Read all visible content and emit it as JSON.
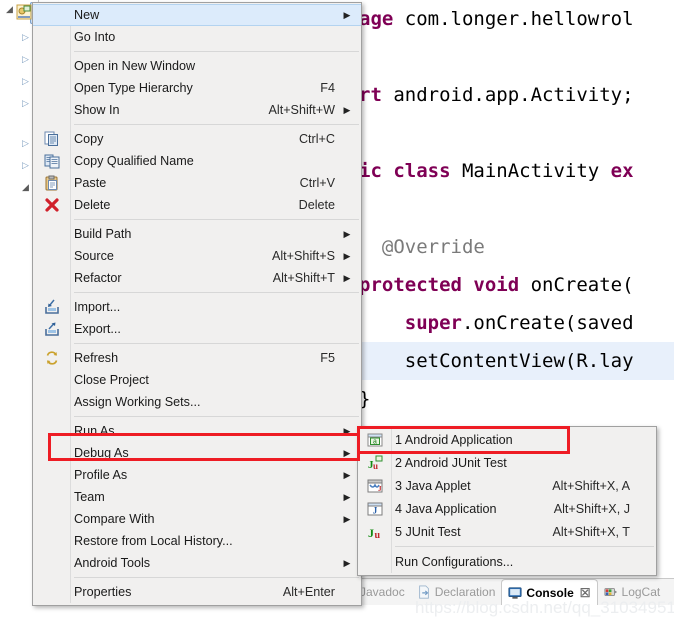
{
  "app": "Eclipse IDE - Package Explorer context menu",
  "editor": {
    "code_lines": [
      {
        "id": "l1",
        "segments": [
          {
            "t": "age ",
            "c": "kw"
          },
          {
            "t": "com.longer.hellowrol",
            "c": "plain"
          }
        ],
        "highlight": false
      },
      {
        "id": "l2",
        "segments": [
          {
            "t": "",
            "c": "plain"
          }
        ],
        "highlight": false
      },
      {
        "id": "l3",
        "segments": [
          {
            "t": "rt ",
            "c": "kw"
          },
          {
            "t": "android.app.Activity;",
            "c": "plain"
          }
        ],
        "highlight": false
      },
      {
        "id": "l4",
        "segments": [
          {
            "t": "",
            "c": "plain"
          }
        ],
        "highlight": false
      },
      {
        "id": "l5",
        "segments": [
          {
            "t": "ic class ",
            "c": "kw"
          },
          {
            "t": "MainActivity ",
            "c": "plain"
          },
          {
            "t": "ex",
            "c": "kw"
          }
        ],
        "highlight": false
      },
      {
        "id": "l6",
        "segments": [
          {
            "t": "",
            "c": "plain"
          }
        ],
        "highlight": false
      },
      {
        "id": "l7",
        "segments": [
          {
            "t": "  @Override",
            "c": "ann"
          }
        ],
        "highlight": false
      },
      {
        "id": "l8",
        "segments": [
          {
            "t": "protected void ",
            "c": "kw"
          },
          {
            "t": "onCreate(",
            "c": "plain"
          }
        ],
        "highlight": false
      },
      {
        "id": "l9",
        "segments": [
          {
            "t": "    ",
            "c": "plain"
          },
          {
            "t": "super",
            "c": "kw"
          },
          {
            "t": ".onCreate(saved",
            "c": "plain"
          }
        ],
        "highlight": false
      },
      {
        "id": "l10",
        "segments": [
          {
            "t": "    setContentView(R.lay",
            "c": "plain"
          }
        ],
        "highlight": true
      },
      {
        "id": "l11",
        "segments": [
          {
            "t": "}",
            "c": "plain"
          }
        ],
        "highlight": false
      }
    ]
  },
  "context_menu": {
    "items": [
      {
        "label": "New",
        "accel": "",
        "arrow": true,
        "icon": "",
        "hover": true
      },
      {
        "label": "Go Into",
        "accel": "",
        "arrow": false,
        "icon": "",
        "hover": false
      },
      {
        "separator": true
      },
      {
        "label": "Open in New Window",
        "accel": "",
        "arrow": false,
        "icon": "",
        "hover": false
      },
      {
        "label": "Open Type Hierarchy",
        "accel": "F4",
        "arrow": false,
        "icon": "",
        "hover": false
      },
      {
        "label": "Show In",
        "accel": "Alt+Shift+W",
        "arrow": true,
        "icon": "",
        "hover": false
      },
      {
        "separator": true
      },
      {
        "label": "Copy",
        "accel": "Ctrl+C",
        "arrow": false,
        "icon": "copy-icon",
        "hover": false
      },
      {
        "label": "Copy Qualified Name",
        "accel": "",
        "arrow": false,
        "icon": "copy-qualified-icon",
        "hover": false
      },
      {
        "label": "Paste",
        "accel": "Ctrl+V",
        "arrow": false,
        "icon": "paste-icon",
        "hover": false
      },
      {
        "label": "Delete",
        "accel": "Delete",
        "arrow": false,
        "icon": "delete-icon",
        "hover": false
      },
      {
        "separator": true
      },
      {
        "label": "Build Path",
        "accel": "",
        "arrow": true,
        "icon": "",
        "hover": false
      },
      {
        "label": "Source",
        "accel": "Alt+Shift+S",
        "arrow": true,
        "icon": "",
        "hover": false
      },
      {
        "label": "Refactor",
        "accel": "Alt+Shift+T",
        "arrow": true,
        "icon": "",
        "hover": false
      },
      {
        "separator": true
      },
      {
        "label": "Import...",
        "accel": "",
        "arrow": false,
        "icon": "import-icon",
        "hover": false
      },
      {
        "label": "Export...",
        "accel": "",
        "arrow": false,
        "icon": "export-icon",
        "hover": false
      },
      {
        "separator": true
      },
      {
        "label": "Refresh",
        "accel": "F5",
        "arrow": false,
        "icon": "refresh-icon",
        "hover": false
      },
      {
        "label": "Close Project",
        "accel": "",
        "arrow": false,
        "icon": "",
        "hover": false
      },
      {
        "label": "Assign Working Sets...",
        "accel": "",
        "arrow": false,
        "icon": "",
        "hover": false
      },
      {
        "separator": true
      },
      {
        "label": "Run As",
        "accel": "",
        "arrow": true,
        "icon": "",
        "hover": false,
        "highlighted_box": true
      },
      {
        "label": "Debug As",
        "accel": "",
        "arrow": true,
        "icon": "",
        "hover": false
      },
      {
        "label": "Profile As",
        "accel": "",
        "arrow": true,
        "icon": "",
        "hover": false
      },
      {
        "label": "Team",
        "accel": "",
        "arrow": true,
        "icon": "",
        "hover": false
      },
      {
        "label": "Compare With",
        "accel": "",
        "arrow": true,
        "icon": "",
        "hover": false
      },
      {
        "label": "Restore from Local History...",
        "accel": "",
        "arrow": false,
        "icon": "",
        "hover": false
      },
      {
        "label": "Android Tools",
        "accel": "",
        "arrow": true,
        "icon": "",
        "hover": false
      },
      {
        "separator": true
      },
      {
        "label": "Properties",
        "accel": "Alt+Enter",
        "arrow": false,
        "icon": "",
        "hover": false
      }
    ]
  },
  "run_as_submenu": {
    "items": [
      {
        "label": "1 Android Application",
        "accel": "",
        "icon": "android-app-icon",
        "highlighted_box": true
      },
      {
        "label": "2 Android JUnit Test",
        "accel": "",
        "icon": "android-junit-icon"
      },
      {
        "label": "3 Java Applet",
        "accel": "Alt+Shift+X, A",
        "icon": "java-applet-icon"
      },
      {
        "label": "4 Java Application",
        "accel": "Alt+Shift+X, J",
        "icon": "java-app-icon"
      },
      {
        "label": "5 JUnit Test",
        "accel": "Alt+Shift+X, T",
        "icon": "junit-icon"
      },
      {
        "separator": true
      },
      {
        "label": "Run Configurations...",
        "accel": "",
        "icon": ""
      }
    ]
  },
  "bottom_tabs": [
    {
      "label": "Javadoc",
      "icon": "javadoc-icon",
      "active": false,
      "closable": false
    },
    {
      "label": "Declaration",
      "icon": "declaration-icon",
      "active": false,
      "closable": false
    },
    {
      "label": "Console",
      "icon": "console-icon",
      "active": true,
      "closable": true
    },
    {
      "label": "LogCat",
      "icon": "logcat-icon",
      "active": false,
      "closable": false
    }
  ],
  "watermark": "https://blog.csdn.net/qq_31034951",
  "colors": {
    "menu_bg": "#f1f0ef",
    "menu_border": "#a0a0a0",
    "hover_bg": "#dcebfb",
    "annotation_red": "#ee1c24",
    "keyword_purple": "#7f0055",
    "code_highlight": "#e8f0fb"
  },
  "tree": {
    "selected_project_icon": "android-project-icon",
    "twisties": [
      "open",
      "closed",
      "closed",
      "closed",
      "closed",
      "closed",
      "closed",
      "open"
    ]
  }
}
